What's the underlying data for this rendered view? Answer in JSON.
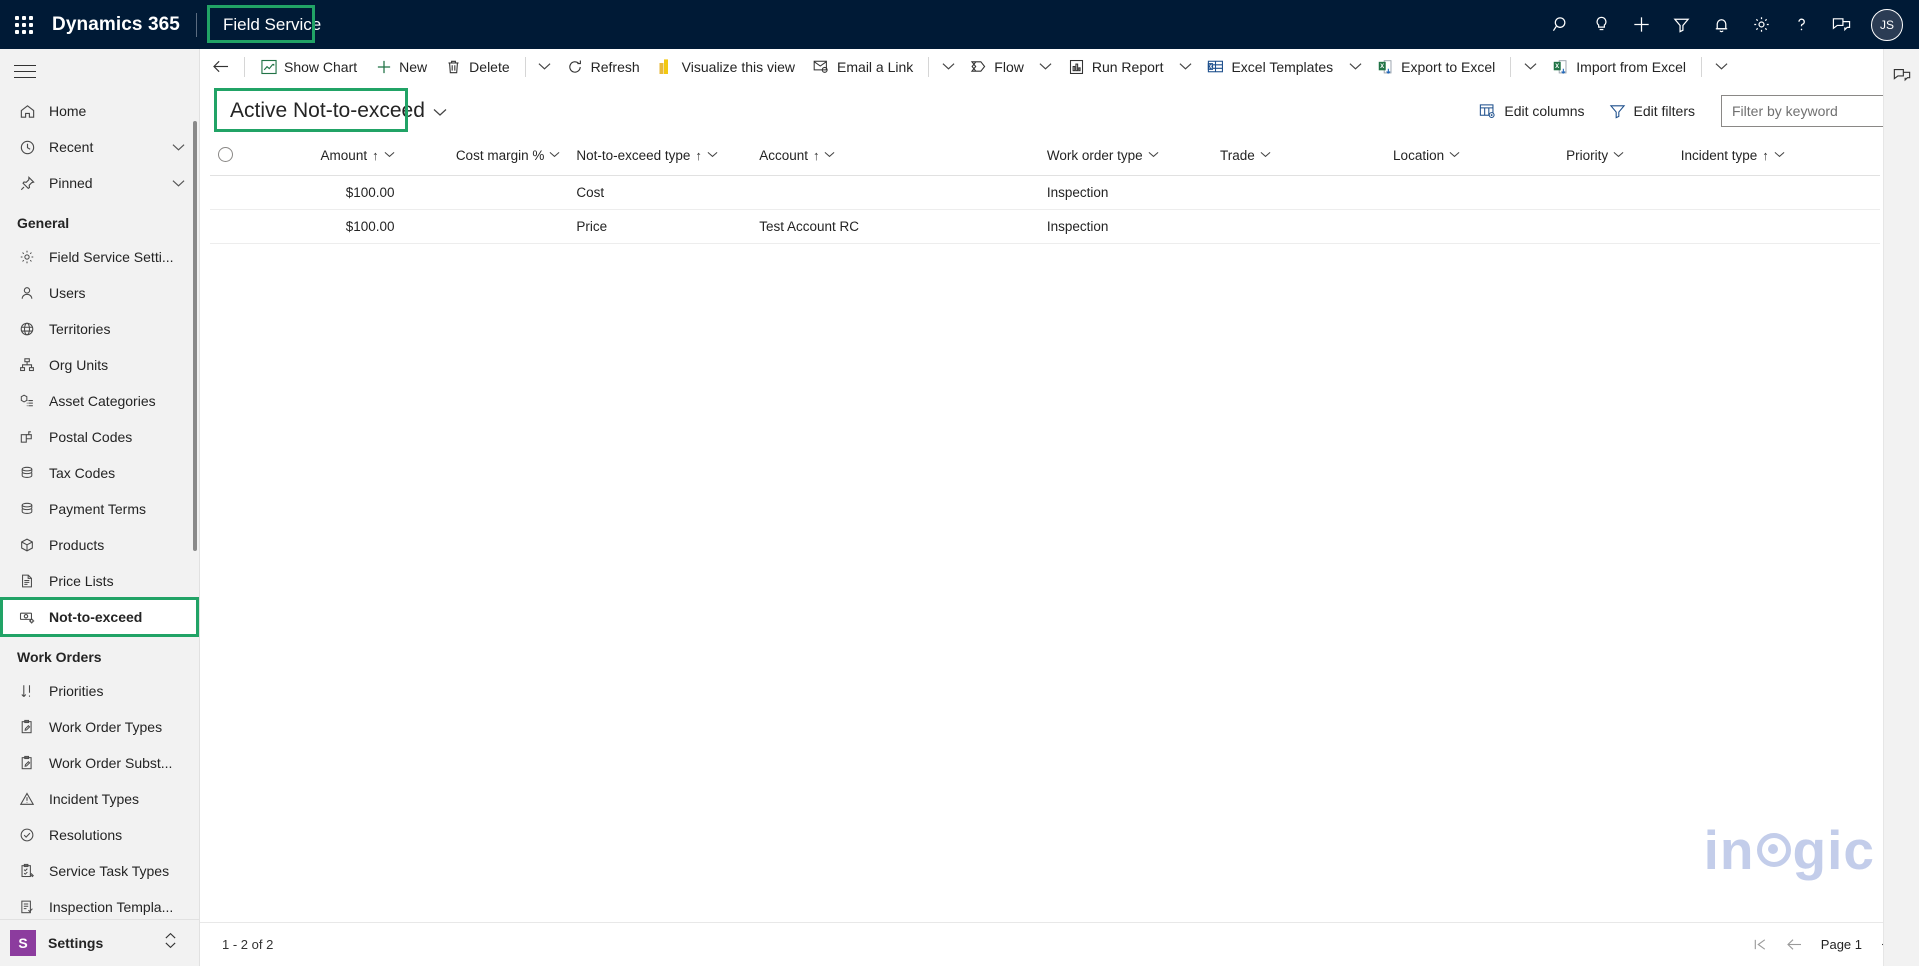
{
  "header": {
    "waffle_label": "app-launcher",
    "brand": "Dynamics 365",
    "app_name": "Field Service",
    "icons": [
      {
        "name": "search-icon",
        "label": "Search"
      },
      {
        "name": "lightbulb-icon",
        "label": "Ideas"
      },
      {
        "name": "plus-icon",
        "label": "Quick create"
      },
      {
        "name": "filter-icon",
        "label": "Filter"
      },
      {
        "name": "bell-icon",
        "label": "Notifications"
      },
      {
        "name": "gear-icon",
        "label": "Settings"
      },
      {
        "name": "help-icon",
        "label": "Help"
      },
      {
        "name": "feedback-icon",
        "label": "Feedback"
      }
    ],
    "avatar_initials": "JS"
  },
  "sidebar": {
    "hamburger_label": "Site map",
    "top_items": [
      {
        "label": "Home",
        "icon": "home-icon",
        "chevron": false
      },
      {
        "label": "Recent",
        "icon": "clock-icon",
        "chevron": true
      },
      {
        "label": "Pinned",
        "icon": "pin-icon",
        "chevron": true
      }
    ],
    "groups": [
      {
        "title": "General",
        "items": [
          {
            "label": "Field Service Setti...",
            "icon": "gear-icon",
            "selected": false
          },
          {
            "label": "Users",
            "icon": "person-icon",
            "selected": false
          },
          {
            "label": "Territories",
            "icon": "globe-icon",
            "selected": false
          },
          {
            "label": "Org Units",
            "icon": "org-chart-icon",
            "selected": false
          },
          {
            "label": "Asset Categories",
            "icon": "asset-category-icon",
            "selected": false
          },
          {
            "label": "Postal Codes",
            "icon": "mailbox-icon",
            "selected": false
          },
          {
            "label": "Tax Codes",
            "icon": "stack-icon",
            "selected": false
          },
          {
            "label": "Payment Terms",
            "icon": "stack-icon",
            "selected": false
          },
          {
            "label": "Products",
            "icon": "box-icon",
            "selected": false
          },
          {
            "label": "Price Lists",
            "icon": "document-icon",
            "selected": false
          },
          {
            "label": "Not-to-exceed",
            "icon": "money-gear-icon",
            "selected": true
          }
        ]
      },
      {
        "title": "Work Orders",
        "items": [
          {
            "label": "Priorities",
            "icon": "sort-icon",
            "selected": false
          },
          {
            "label": "Work Order Types",
            "icon": "clipboard-pen-icon",
            "selected": false
          },
          {
            "label": "Work Order Subst...",
            "icon": "clipboard-pen-icon",
            "selected": false
          },
          {
            "label": "Incident Types",
            "icon": "warning-icon",
            "selected": false
          },
          {
            "label": "Resolutions",
            "icon": "check-circle-icon",
            "selected": false
          },
          {
            "label": "Service Task Types",
            "icon": "clipboard-task-icon",
            "selected": false
          },
          {
            "label": "Inspection Templa...",
            "icon": "inspection-icon",
            "selected": false
          }
        ]
      }
    ],
    "footer": {
      "badge": "S",
      "label": "Settings",
      "expander_icon": "up-down-chevron-icon"
    }
  },
  "command_bar": {
    "back_icon": "back-arrow-icon",
    "buttons": [
      {
        "label": "Show Chart",
        "icon": "chart-icon",
        "caret": false
      },
      {
        "label": "New",
        "icon": "plus-icon",
        "caret": false
      },
      {
        "label": "Delete",
        "icon": "trash-icon",
        "caret": true
      },
      {
        "label": "Refresh",
        "icon": "refresh-icon",
        "caret": false
      },
      {
        "label": "Visualize this view",
        "icon": "powerbi-icon",
        "caret": false
      },
      {
        "label": "Email a Link",
        "icon": "email-link-icon",
        "caret": true
      },
      {
        "label": "Flow",
        "icon": "flow-icon",
        "caret": true
      },
      {
        "label": "Run Report",
        "icon": "report-icon",
        "caret": true
      },
      {
        "label": "Excel Templates",
        "icon": "excel-template-icon",
        "caret": true
      },
      {
        "label": "Export to Excel",
        "icon": "excel-export-icon",
        "caret": true
      },
      {
        "label": "Import from Excel",
        "icon": "excel-import-icon",
        "caret": true
      }
    ]
  },
  "view_bar": {
    "selected_view": "Active Not-to-exceed",
    "view_caret_icon": "chevron-down-icon",
    "edit_columns": "Edit columns",
    "edit_filters": "Edit filters",
    "search_placeholder": "Filter by keyword",
    "search_value": ""
  },
  "grid": {
    "select_all_name": "select-all-checkbox",
    "columns": [
      {
        "label": "Amount",
        "sorted": true,
        "align": "right"
      },
      {
        "label": "Cost margin %",
        "sorted": false,
        "align": "right"
      },
      {
        "label": "Not-to-exceed type",
        "sorted": true,
        "align": "left"
      },
      {
        "label": "Account",
        "sorted": true,
        "align": "left"
      },
      {
        "label": "Work order type",
        "sorted": false,
        "align": "left"
      },
      {
        "label": "Trade",
        "sorted": false,
        "align": "left"
      },
      {
        "label": "Location",
        "sorted": false,
        "align": "left"
      },
      {
        "label": "Priority",
        "sorted": false,
        "align": "left"
      },
      {
        "label": "Incident type",
        "sorted": true,
        "align": "left"
      }
    ],
    "rows": [
      {
        "amount": "$100.00",
        "cost_margin": "",
        "nte_type": "Cost",
        "account": "",
        "work_order_type": "Inspection",
        "trade": "",
        "location": "",
        "priority": "",
        "incident_type": ""
      },
      {
        "amount": "$100.00",
        "cost_margin": "",
        "nte_type": "Price",
        "account": "Test Account RC",
        "work_order_type": "Inspection",
        "trade": "",
        "location": "",
        "priority": "",
        "incident_type": ""
      }
    ],
    "sort_arrow": "↑",
    "chevron": "⌄"
  },
  "footer": {
    "record_count": "1 - 2 of 2",
    "first_page_icon": "first-page-icon",
    "prev_page_icon": "previous-page-icon",
    "page_label": "Page 1",
    "next_page_icon": "next-page-icon"
  },
  "watermark": {
    "text_before": "in",
    "text_after": "gic"
  },
  "colors": {
    "header_bg": "#001a36",
    "accent_green": "#21a366",
    "link_blue": "#1160b0",
    "selected_bar": "#2266c8",
    "settings_purple": "#8c3c9e",
    "watermark": "#c3cdea"
  }
}
